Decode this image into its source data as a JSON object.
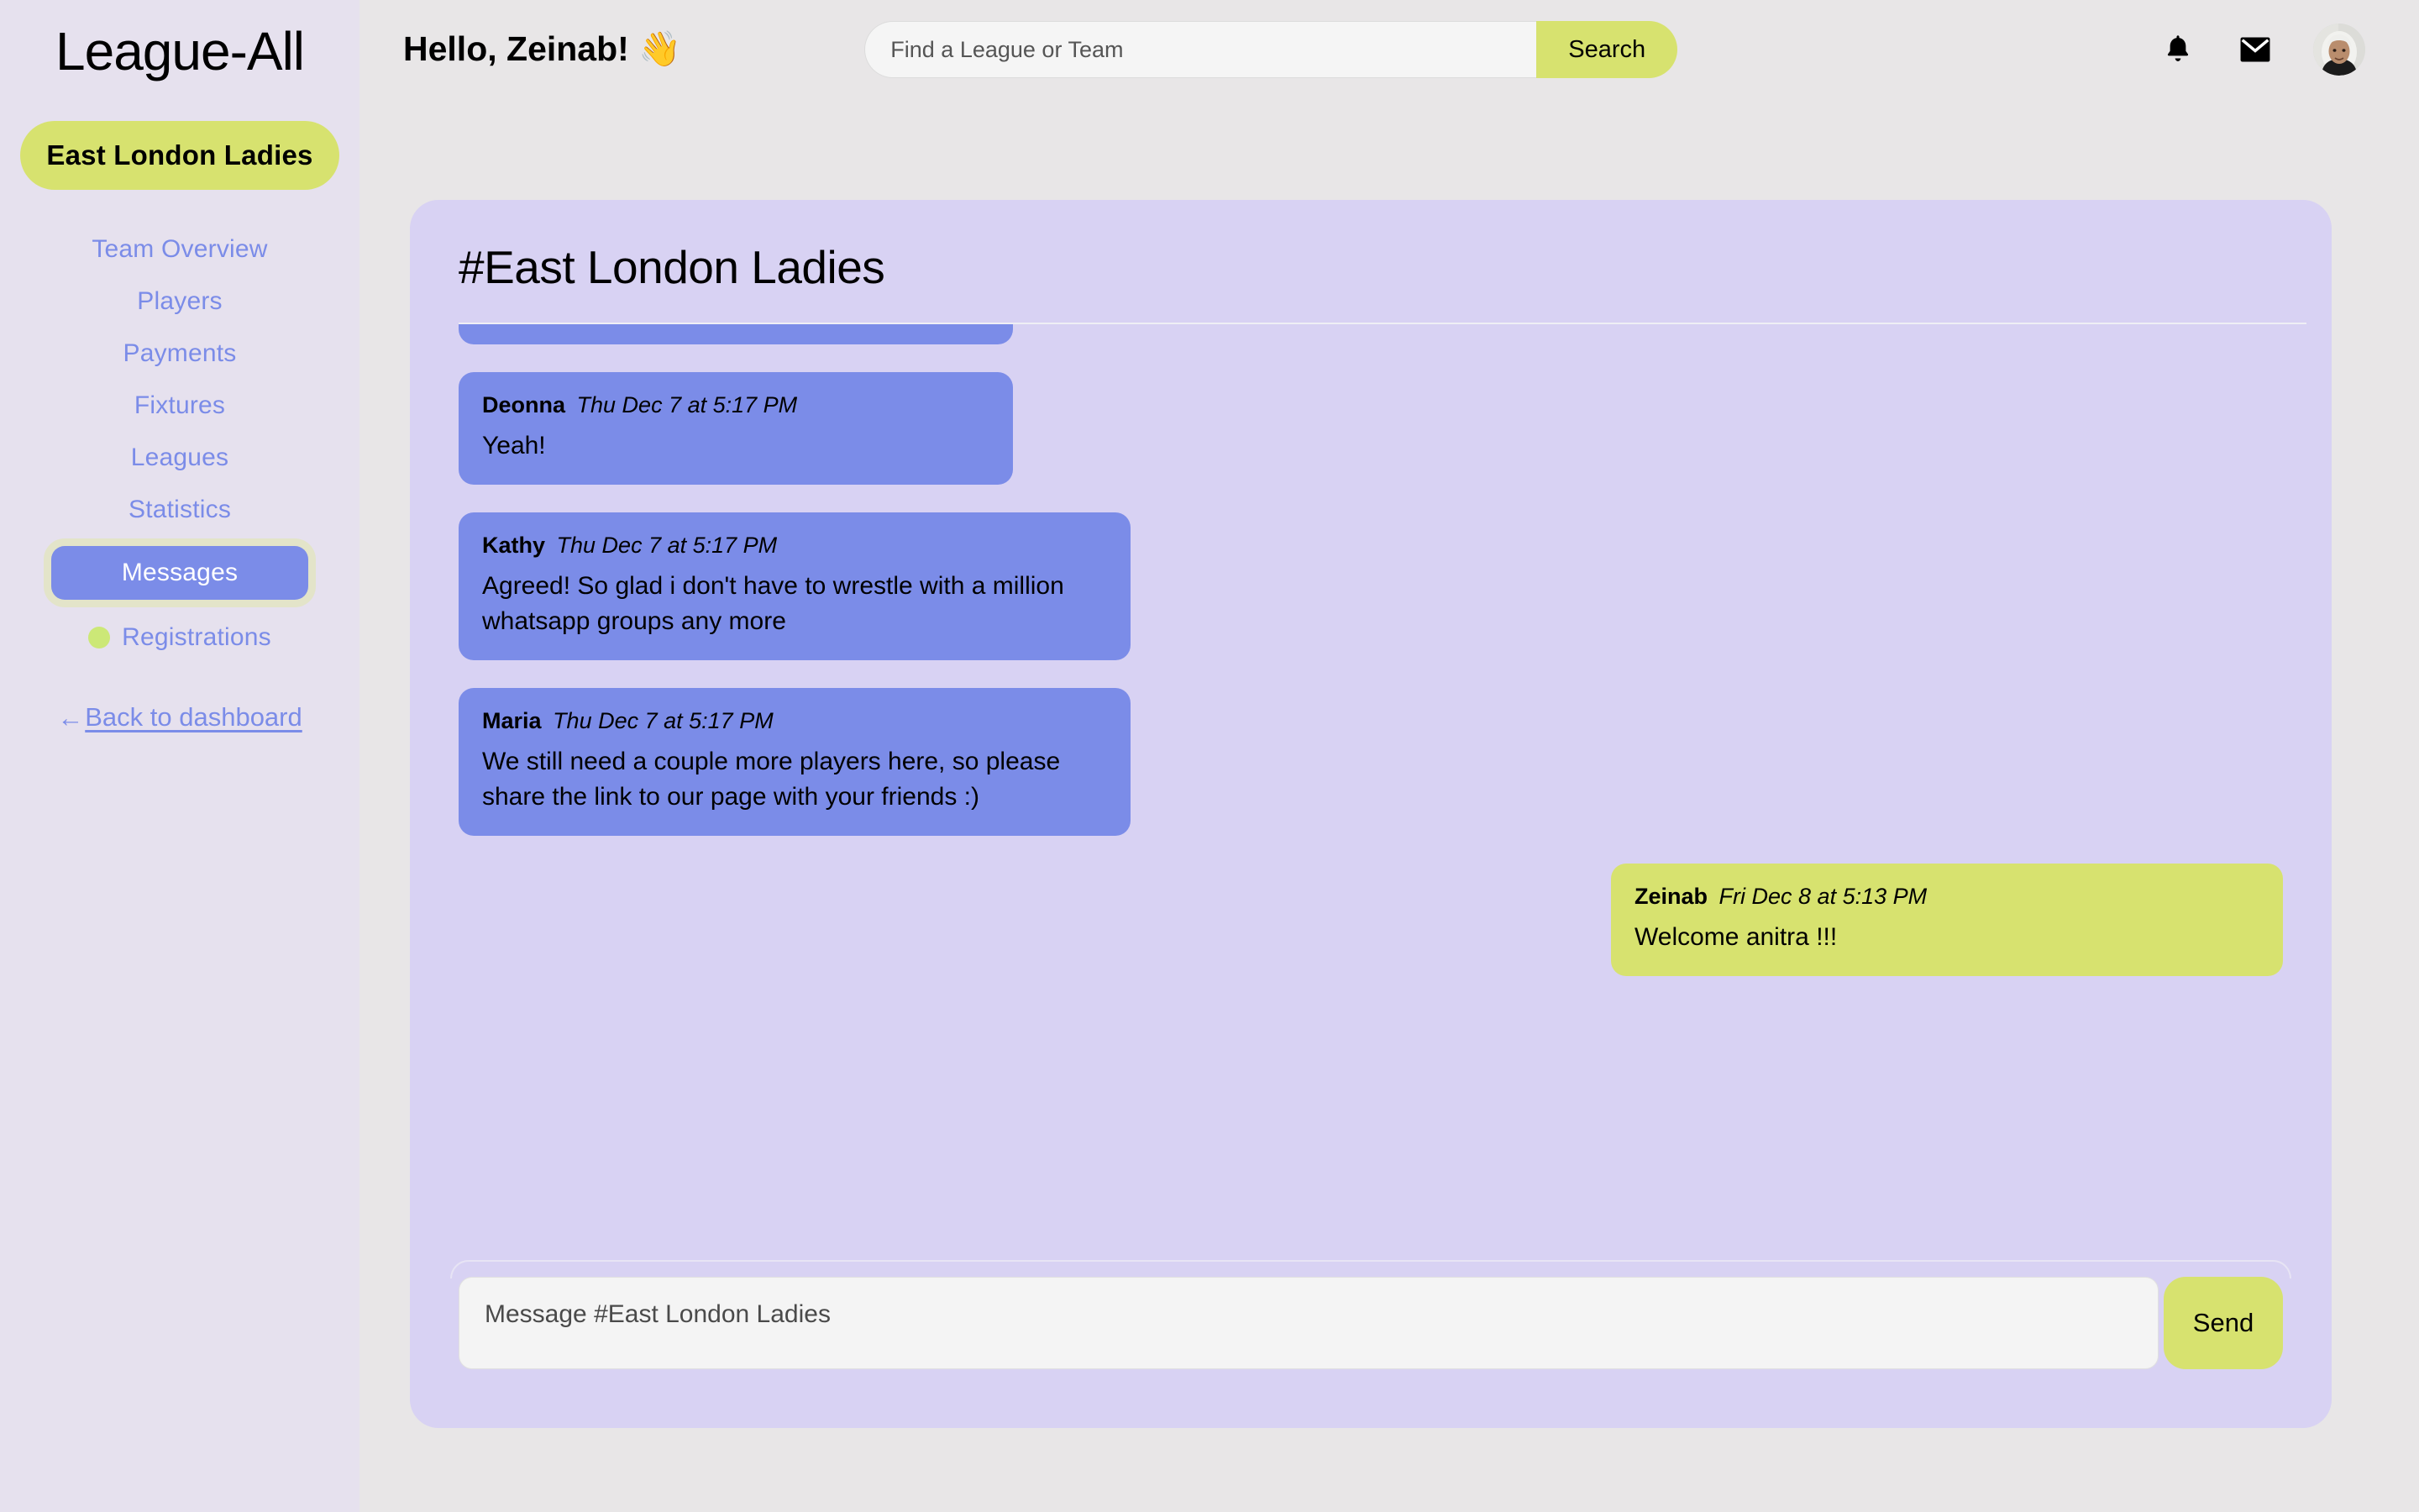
{
  "brand": {
    "logo": "League-All"
  },
  "sidebar": {
    "team_pill": "East London Ladies",
    "items": [
      {
        "label": "Team Overview",
        "active": false,
        "dot": false
      },
      {
        "label": "Players",
        "active": false,
        "dot": false
      },
      {
        "label": "Payments",
        "active": false,
        "dot": false
      },
      {
        "label": "Fixtures",
        "active": false,
        "dot": false
      },
      {
        "label": "Leagues",
        "active": false,
        "dot": false
      },
      {
        "label": "Statistics",
        "active": false,
        "dot": false
      },
      {
        "label": "Messages",
        "active": true,
        "dot": false
      },
      {
        "label": "Registrations",
        "active": false,
        "dot": true
      }
    ],
    "back_arrow": "←",
    "back_label": "Back to dashboard"
  },
  "topbar": {
    "greeting": "Hello, Zeinab!",
    "greeting_emoji": "👋",
    "search_placeholder": "Find a League or Team",
    "search_value": "",
    "search_button": "Search",
    "notifications_icon": "bell-icon",
    "mail_icon": "envelope-icon",
    "avatar_alt": "user-avatar"
  },
  "chat": {
    "title": "#East London Ladies",
    "messages": [
      {
        "author": "",
        "time": "",
        "text": "",
        "mine": false,
        "partial": true
      },
      {
        "author": "Deonna",
        "time": "Thu Dec 7 at 5:17 PM",
        "text": "Yeah!",
        "mine": false,
        "partial": false
      },
      {
        "author": "Kathy",
        "time": "Thu Dec 7 at 5:17 PM",
        "text": "Agreed! So glad i don't have to wrestle with a million whatsapp groups any more",
        "mine": false,
        "partial": false
      },
      {
        "author": "Maria",
        "time": "Thu Dec 7 at 5:17 PM",
        "text": "We still need a couple more players here, so please share the link to our page with your friends :)",
        "mine": false,
        "partial": false
      },
      {
        "author": "Zeinab",
        "time": "Fri Dec 8 at 5:13 PM",
        "text": "Welcome anitra !!!",
        "mine": true,
        "partial": false
      }
    ],
    "composer_placeholder": "Message #East London Ladies",
    "composer_value": "",
    "send_label": "Send"
  },
  "colors": {
    "accent_green": "#d7e26f",
    "accent_blue": "#7b8ce8",
    "panel_purple": "#d8d2f3",
    "sidebar_bg": "#e6e1ee",
    "page_bg": "#e8e6e7"
  }
}
